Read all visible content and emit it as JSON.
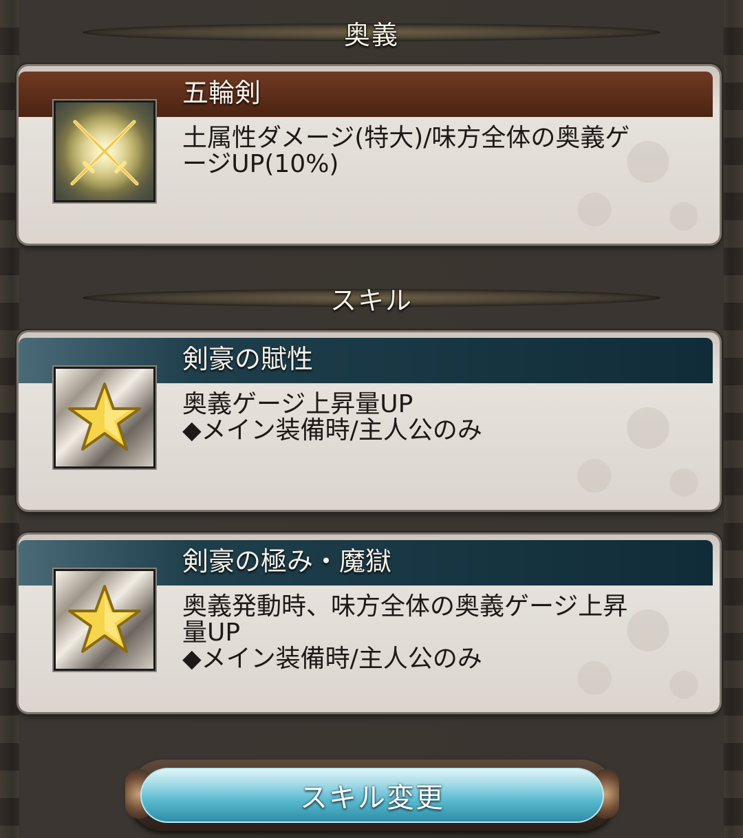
{
  "sections": {
    "ougi_title": "奥義",
    "skill_title": "スキル"
  },
  "ougi": {
    "name": "五輪剣",
    "desc_line1": "土属性ダメージ(特大)/味方全体の奥義ゲ",
    "desc_line2": "ージUP(10%)",
    "icon": "crossed-swords-icon"
  },
  "skills": [
    {
      "name": "剣豪の賦性",
      "desc_line1": "奥義ゲージ上昇量UP",
      "desc_line2": "◆メイン装備時/主人公のみ",
      "icon": "star-icon"
    },
    {
      "name": "剣豪の極み・魔獄",
      "desc_line1": "奥義発動時、味方全体の奥義ゲージ上昇",
      "desc_line2": "量UP",
      "desc_line3": "◆メイン装備時/主人公のみ",
      "icon": "star-icon"
    }
  ],
  "button": {
    "label": "スキル変更"
  },
  "colors": {
    "ougi_bar": "#5a2c18",
    "skill_bar": "#102c38",
    "button": "#59b9cf"
  }
}
